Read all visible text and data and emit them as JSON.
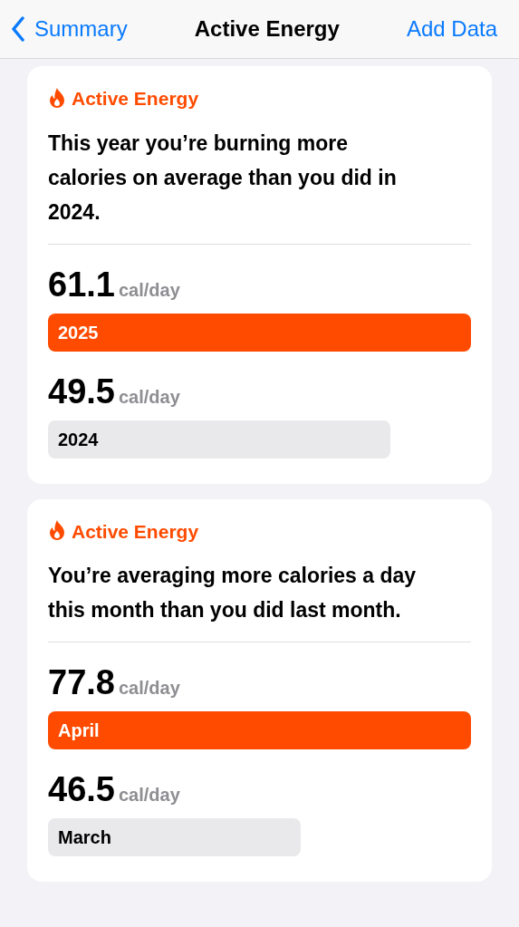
{
  "nav": {
    "back": "Summary",
    "title": "Active Energy",
    "action": "Add Data"
  },
  "cards": [
    {
      "header": "Active Energy",
      "headline": "This year you’re burning more calories on average than you did in 2024.",
      "rows": [
        {
          "value": "61.1",
          "unit": "cal/day",
          "label": "2025",
          "kind": "current"
        },
        {
          "value": "49.5",
          "unit": "cal/day",
          "label": "2024",
          "kind": "previous"
        }
      ]
    },
    {
      "header": "Active Energy",
      "headline": "You’re averaging more calories a day this month than you did last month.",
      "rows": [
        {
          "value": "77.8",
          "unit": "cal/day",
          "label": "April",
          "kind": "current"
        },
        {
          "value": "46.5",
          "unit": "cal/day",
          "label": "March",
          "kind": "previous"
        }
      ]
    }
  ]
}
